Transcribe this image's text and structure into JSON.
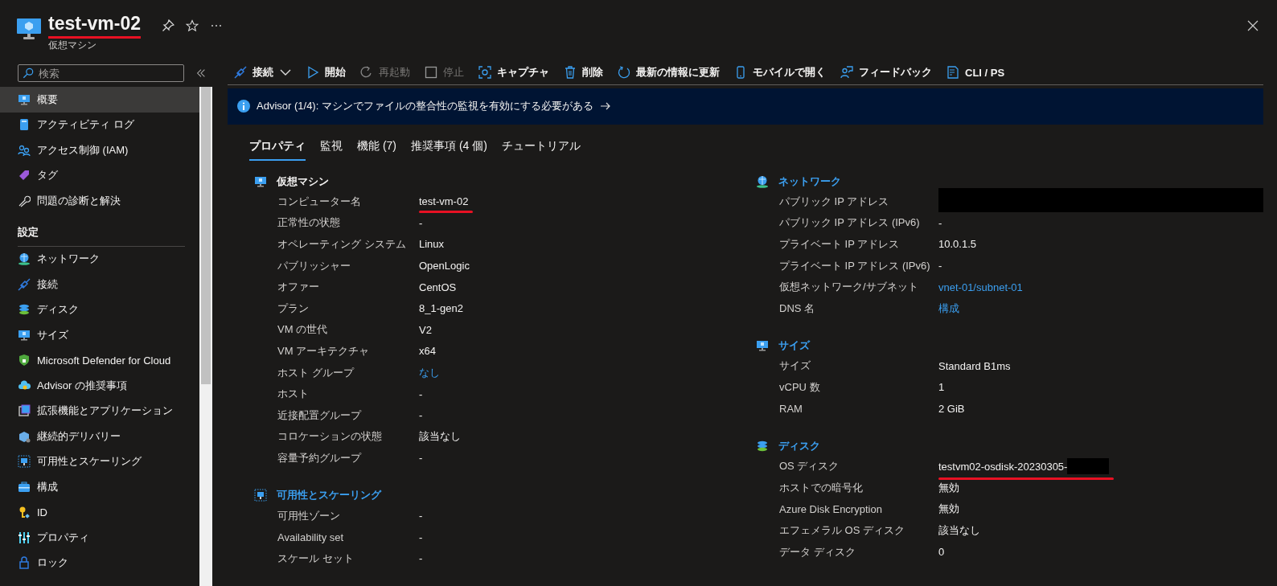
{
  "header": {
    "title": "test-vm-02",
    "title_underlined": true,
    "subtitle": "仮想マシン"
  },
  "sidebar": {
    "search": {
      "placeholder": "検索"
    },
    "items": [
      {
        "label": "概要",
        "selected": true
      },
      {
        "label": "アクティビティ ログ",
        "selected": false
      },
      {
        "label": "アクセス制御 (IAM)",
        "selected": false
      },
      {
        "label": "タグ",
        "selected": false
      },
      {
        "label": "問題の診断と解決",
        "selected": false
      }
    ],
    "sections": [
      {
        "title": "設定",
        "items": [
          {
            "label": "ネットワーク",
            "selected": false
          },
          {
            "label": "接続",
            "selected": false
          },
          {
            "label": "ディスク",
            "selected": false
          },
          {
            "label": "サイズ",
            "selected": false
          },
          {
            "label": "Microsoft Defender for Cloud",
            "selected": false
          },
          {
            "label": "Advisor の推奨事項",
            "selected": false
          },
          {
            "label": "拡張機能とアプリケーション",
            "selected": false
          },
          {
            "label": "継続的デリバリー",
            "selected": false
          },
          {
            "label": "可用性とスケーリング",
            "selected": false
          },
          {
            "label": "構成",
            "selected": false
          },
          {
            "label": "ID",
            "selected": false
          },
          {
            "label": "プロパティ",
            "selected": false
          },
          {
            "label": "ロック",
            "selected": false
          }
        ]
      }
    ]
  },
  "toolbar": [
    {
      "label": "接続",
      "disabled": false,
      "dropdown": true
    },
    {
      "label": "開始",
      "disabled": false,
      "dropdown": false
    },
    {
      "label": "再起動",
      "disabled": true,
      "dropdown": false
    },
    {
      "label": "停止",
      "disabled": true,
      "dropdown": false
    },
    {
      "label": "キャプチャ",
      "disabled": false,
      "dropdown": false
    },
    {
      "label": "削除",
      "disabled": false,
      "dropdown": false
    },
    {
      "label": "最新の情報に更新",
      "disabled": false,
      "dropdown": false
    },
    {
      "label": "モバイルで開く",
      "disabled": false,
      "dropdown": false
    },
    {
      "label": "フィードバック",
      "disabled": false,
      "dropdown": false
    },
    {
      "label": "CLI / PS",
      "disabled": false,
      "dropdown": false
    }
  ],
  "banner": {
    "text": "Advisor (1/4): マシンでファイルの整合性の監視を有効にする必要がある"
  },
  "tabs": [
    {
      "label": "プロパティ",
      "selected": true
    },
    {
      "label": "監視",
      "selected": false
    },
    {
      "label": "機能 (7)",
      "selected": false
    },
    {
      "label": "推奨事項 (4 個)",
      "selected": false
    },
    {
      "label": "チュートリアル",
      "selected": false
    }
  ],
  "columns": [
    [
      {
        "title": "仮想マシン",
        "link": false,
        "rows": [
          {
            "label": "コンピューター名",
            "value": "test-vm-02",
            "link": false,
            "underlined": true
          },
          {
            "label": "正常性の状態",
            "value": "-",
            "link": false
          },
          {
            "label": "オペレーティング システム",
            "value": "Linux",
            "link": false
          },
          {
            "label": "パブリッシャー",
            "value": "OpenLogic",
            "link": false
          },
          {
            "label": "オファー",
            "value": "CentOS",
            "link": false
          },
          {
            "label": "プラン",
            "value": "8_1-gen2",
            "link": false
          },
          {
            "label": "VM の世代",
            "value": "V2",
            "link": false
          },
          {
            "label": "VM アーキテクチャ",
            "value": "x64",
            "link": false
          },
          {
            "label": "ホスト グループ",
            "value": "なし",
            "link": true
          },
          {
            "label": "ホスト",
            "value": "-",
            "link": false
          },
          {
            "label": "近接配置グループ",
            "value": "-",
            "link": false
          },
          {
            "label": "コロケーションの状態",
            "value": "該当なし",
            "link": false
          },
          {
            "label": "容量予約グループ",
            "value": "-",
            "link": false
          }
        ]
      },
      {
        "title": "可用性とスケーリング",
        "link": true,
        "rows": [
          {
            "label": "可用性ゾーン",
            "value": "-",
            "link": false
          },
          {
            "label": "Availability set",
            "value": "-",
            "link": false
          },
          {
            "label": "スケール セット",
            "value": "-",
            "link": false
          }
        ]
      }
    ],
    [
      {
        "title": "ネットワーク",
        "link": true,
        "rows": [
          {
            "label": "パブリック IP アドレス",
            "redacted": true
          },
          {
            "label": "パブリック IP アドレス (IPv6)",
            "value": "-",
            "link": false
          },
          {
            "label": "プライベート IP アドレス",
            "value": "10.0.1.5",
            "link": false
          },
          {
            "label": "プライベート IP アドレス (IPv6)",
            "value": "-",
            "link": false
          },
          {
            "label": "仮想ネットワーク/サブネット",
            "value": "vnet-01/subnet-01",
            "link": true
          },
          {
            "label": "DNS 名",
            "value": "構成",
            "link": true
          }
        ]
      },
      {
        "title": "サイズ",
        "link": true,
        "rows": [
          {
            "label": "サイズ",
            "value": "Standard B1ms",
            "link": false
          },
          {
            "label": "vCPU 数",
            "value": "1",
            "link": false
          },
          {
            "label": "RAM",
            "value": "2 GiB",
            "link": false
          }
        ]
      },
      {
        "title": "ディスク",
        "link": true,
        "rows": [
          {
            "label": "OS ディスク",
            "value": "testvm02-osdisk-20230305-",
            "link": false,
            "underlined": true,
            "redacted": true
          },
          {
            "label": "ホストでの暗号化",
            "value": "無効",
            "link": false
          },
          {
            "label": "Azure Disk Encryption",
            "value": "無効",
            "link": false
          },
          {
            "label": "エフェメラル OS ディスク",
            "value": "該当なし",
            "link": false
          },
          {
            "label": "データ ディスク",
            "value": "0",
            "link": false
          }
        ]
      }
    ]
  ]
}
